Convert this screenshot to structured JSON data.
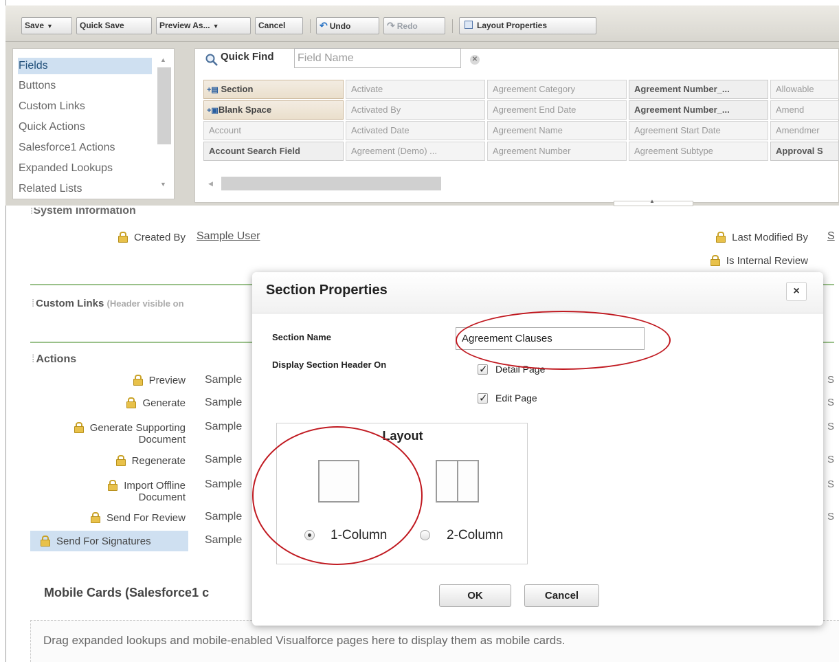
{
  "toolbar": {
    "save": "Save",
    "quick_save": "Quick Save",
    "preview_as": "Preview As...",
    "cancel": "Cancel",
    "undo": "Undo",
    "redo": "Redo",
    "layout_properties": "Layout Properties"
  },
  "palette": {
    "categories": [
      "Fields",
      "Buttons",
      "Custom Links",
      "Quick Actions",
      "Salesforce1 Actions",
      "Expanded Lookups",
      "Related Lists"
    ],
    "selected_category": "Fields",
    "quick_find_label": "Quick Find",
    "quick_find_placeholder": "Field Name",
    "fields": [
      [
        "Section",
        "Activate",
        "Agreement Category",
        "Agreement Number_...",
        "Allowable"
      ],
      [
        "Blank Space",
        "Activated By",
        "Agreement End Date",
        "Agreement Number_...",
        "Amend"
      ],
      [
        "Account",
        "Activated Date",
        "Agreement Name",
        "Agreement Start Date",
        "Amendmer"
      ],
      [
        "Account Search Field",
        "Agreement (Demo) ...",
        "Agreement Number",
        "Agreement Subtype",
        "Approval S"
      ]
    ]
  },
  "layout": {
    "system_information_title": "System Information",
    "created_by_label": "Created By",
    "created_by_value": "Sample User",
    "last_modified_by_label": "Last Modified By",
    "last_modified_by_value": "S",
    "is_internal_review_label": "Is Internal Review",
    "custom_links_title": "Custom Links",
    "custom_links_sub": "(Header visible on",
    "actions_title": "Actions",
    "actions": [
      {
        "label": "Preview",
        "value": "Sample"
      },
      {
        "label": "Generate",
        "value": "Sample"
      },
      {
        "label": "Generate Supporting Document",
        "value": "Sample"
      },
      {
        "label": "Regenerate",
        "value": "Sample"
      },
      {
        "label": "Import Offline Document",
        "value": "Sample"
      },
      {
        "label": "Send For Review",
        "value": "Sample"
      },
      {
        "label": "Send For Signatures",
        "value": "Sample"
      }
    ],
    "right_edge": "S",
    "mobile_cards_title": "Mobile Cards (Salesforce1 c",
    "mobile_cards_hint": "Drag expanded lookups and mobile-enabled Visualforce pages here to display them as mobile cards."
  },
  "dialog": {
    "title": "Section Properties",
    "close_glyph": "×",
    "section_name_label": "Section Name",
    "section_name_value": "Agreement Clauses",
    "display_header_label": "Display Section Header On",
    "detail_page_label": "Detail Page",
    "edit_page_label": "Edit Page",
    "layout_title": "Layout",
    "one_column_label": "1-Column",
    "two_column_label": "2-Column",
    "selected_layout": "1-Column",
    "ok_label": "OK",
    "cancel_label": "Cancel"
  },
  "colors": {
    "annotation_red": "#c01920",
    "selection_blue": "#cfe0f1",
    "section_green": "#9ac18a"
  }
}
